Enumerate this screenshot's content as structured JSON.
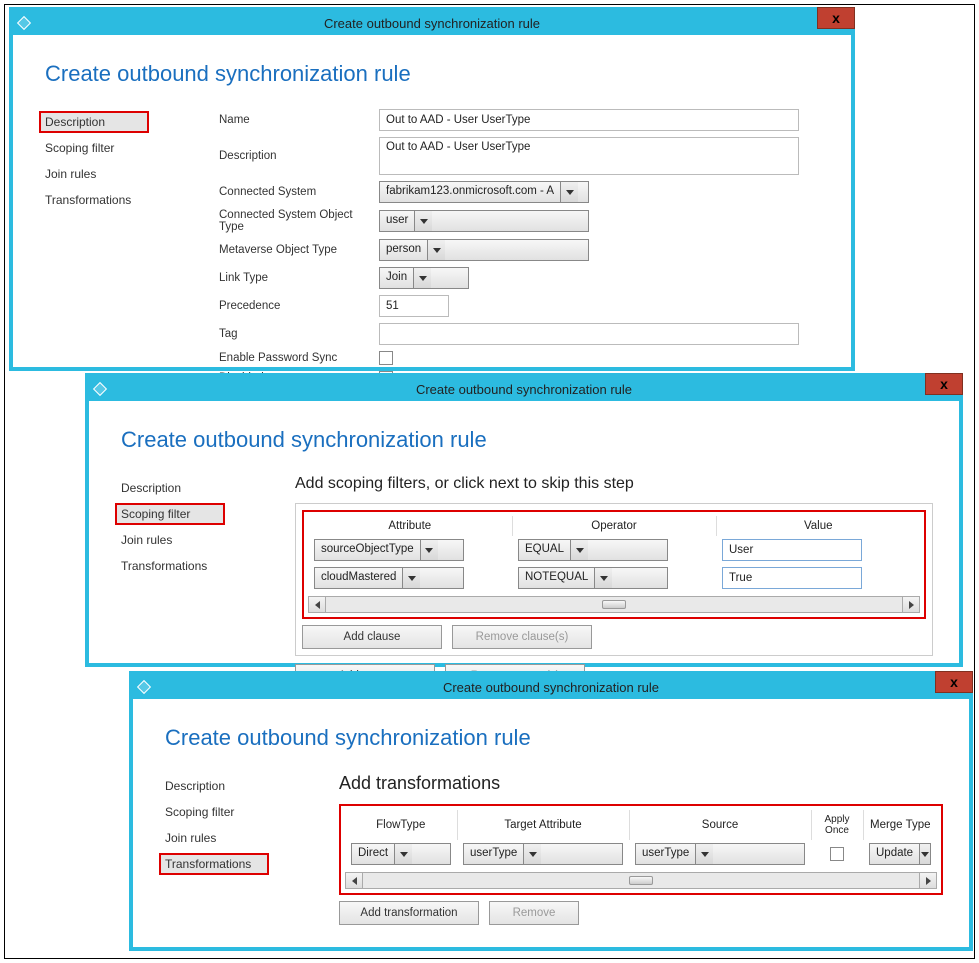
{
  "common": {
    "window_title": "Create outbound synchronization rule",
    "heading": "Create outbound synchronization rule",
    "sidebar": [
      "Description",
      "Scoping filter",
      "Join rules",
      "Transformations"
    ],
    "close": "x"
  },
  "dlg1": {
    "fields": {
      "name_lbl": "Name",
      "name_val": "Out to AAD - User UserType",
      "desc_lbl": "Description",
      "desc_val": "Out to AAD - User UserType",
      "cs_lbl": "Connected System",
      "cs_val": "fabrikam123.onmicrosoft.com - A",
      "csot_lbl": "Connected System Object Type",
      "csot_val": "user",
      "mvot_lbl": "Metaverse Object Type",
      "mvot_val": "person",
      "link_lbl": "Link Type",
      "link_val": "Join",
      "prec_lbl": "Precedence",
      "prec_val": "51",
      "tag_lbl": "Tag",
      "tag_val": "",
      "eps_lbl": "Enable Password Sync",
      "dis_lbl": "Disabled"
    }
  },
  "dlg2": {
    "instr": "Add scoping filters, or click next to skip this step",
    "headers": [
      "Attribute",
      "Operator",
      "Value"
    ],
    "rows": [
      {
        "attr": "sourceObjectType",
        "op": "EQUAL",
        "val": "User"
      },
      {
        "attr": "cloudMastered",
        "op": "NOTEQUAL",
        "val": "True"
      }
    ],
    "btn_add_clause": "Add clause",
    "btn_remove_clause": "Remove clause(s)",
    "btn_add_group": "Add group",
    "btn_remove_group": "Remove group(s)"
  },
  "dlg3": {
    "instr": "Add transformations",
    "headers": [
      "FlowType",
      "Target Attribute",
      "Source",
      "Apply Once",
      "Merge Type"
    ],
    "row": {
      "flow": "Direct",
      "target": "userType",
      "source": "userType",
      "merge": "Update"
    },
    "btn_add": "Add transformation",
    "btn_remove": "Remove"
  }
}
